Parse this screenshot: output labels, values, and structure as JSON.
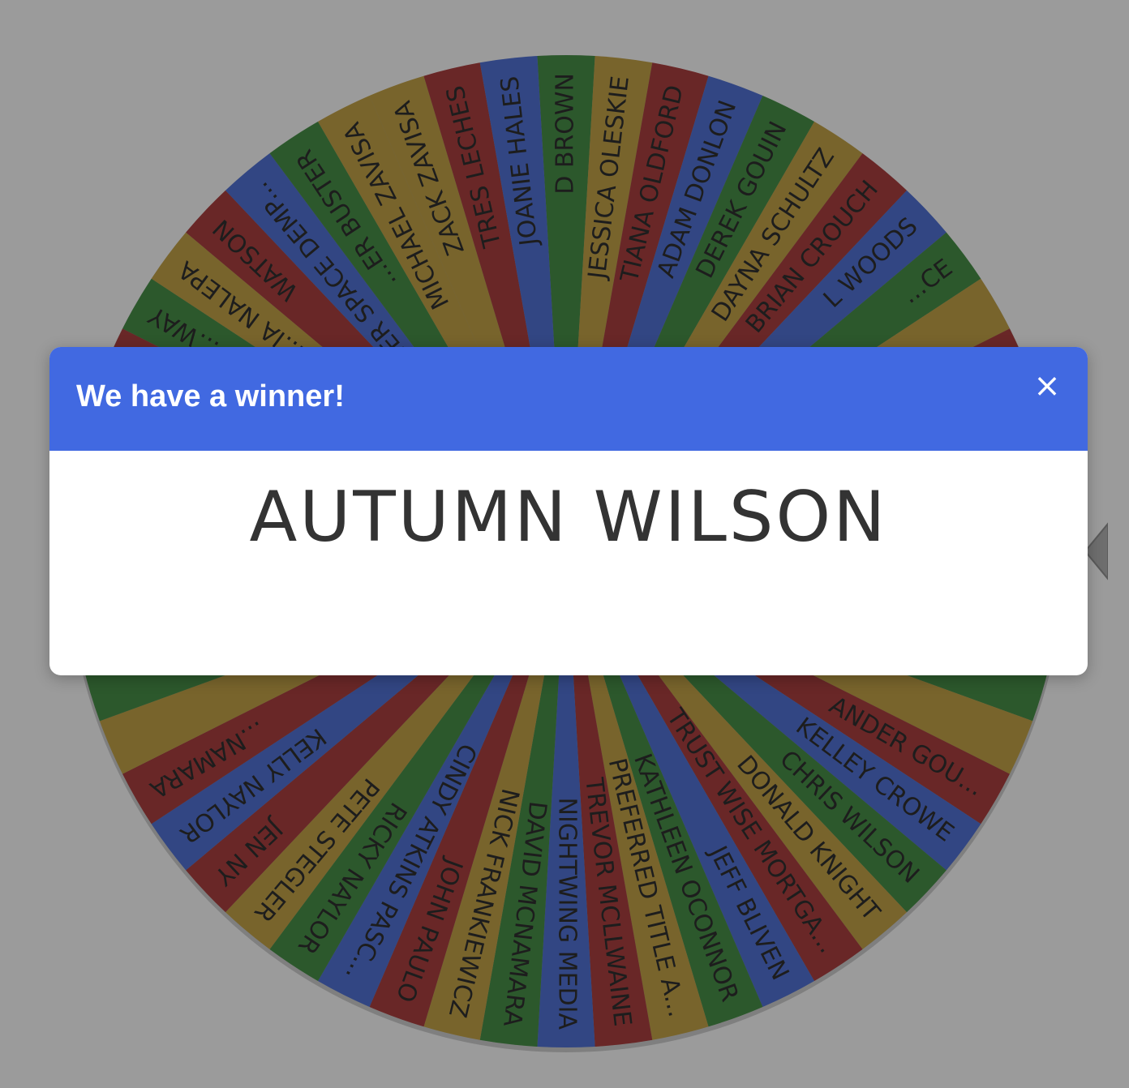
{
  "wheel": {
    "entries": [
      {
        "label": "D BROWN",
        "color": "#266326"
      },
      {
        "label": "JESSICA OLESKIE",
        "color": "#8f7326"
      },
      {
        "label": "TIANA OLDFORD",
        "color": "#7a1f1f"
      },
      {
        "label": "ADAM DONLON",
        "color": "#2e4a9e"
      },
      {
        "label": "DEREK GOUIN",
        "color": "#266326"
      },
      {
        "label": "DAYNA SCHULTZ",
        "color": "#8f7326"
      },
      {
        "label": "BRIAN CROUCH",
        "color": "#7a1f1f"
      },
      {
        "label": "L WOODS",
        "color": "#2e4a9e"
      },
      {
        "label": "...CE",
        "color": "#266326"
      },
      {
        "label": "",
        "color": "#8f7326"
      },
      {
        "label": "",
        "color": "#7a1f1f"
      },
      {
        "label": "",
        "color": "#2e4a9e"
      },
      {
        "label": "",
        "color": "#266326"
      },
      {
        "label": "",
        "color": "#8f7326"
      },
      {
        "label": "",
        "color": "#7a1f1f"
      },
      {
        "label": "",
        "color": "#2e4a9e"
      },
      {
        "label": "",
        "color": "#266326"
      },
      {
        "label": "",
        "color": "#8f7326"
      },
      {
        "label": "ANDER GOU...",
        "color": "#7a1f1f"
      },
      {
        "label": "KELLEY CROWE",
        "color": "#2e4a9e"
      },
      {
        "label": "CHRIS WILSON",
        "color": "#266326"
      },
      {
        "label": "DONALD KNIGHT",
        "color": "#8f7326"
      },
      {
        "label": "TRUST WISE MORTGA...",
        "color": "#7a1f1f"
      },
      {
        "label": "JEFF BLIVEN",
        "color": "#2e4a9e"
      },
      {
        "label": "KATHLEEN OCONNOR",
        "color": "#266326"
      },
      {
        "label": "PREFERRED TITLE A...",
        "color": "#8f7326"
      },
      {
        "label": "TREVOR MCLLWAINE",
        "color": "#7a1f1f"
      },
      {
        "label": "NIGHTWING MEDIA",
        "color": "#2e4a9e"
      },
      {
        "label": "DAVID MCNAMARA",
        "color": "#266326"
      },
      {
        "label": "NICK FRANKIEWICZ",
        "color": "#8f7326"
      },
      {
        "label": "JOHN PAULO",
        "color": "#7a1f1f"
      },
      {
        "label": "CINDY ATKINS PASC...",
        "color": "#2e4a9e"
      },
      {
        "label": "RICKY NAYLOR",
        "color": "#266326"
      },
      {
        "label": "PETE STEGLER",
        "color": "#8f7326"
      },
      {
        "label": "JEN NY",
        "color": "#7a1f1f"
      },
      {
        "label": "KELLY NAYLOR",
        "color": "#2e4a9e"
      },
      {
        "label": "...NAMARA",
        "color": "#7a1f1f"
      },
      {
        "label": "",
        "color": "#8f7326"
      },
      {
        "label": "",
        "color": "#266326"
      },
      {
        "label": "",
        "color": "#2e4a9e"
      },
      {
        "label": "",
        "color": "#7a1f1f"
      },
      {
        "label": "",
        "color": "#8f7326"
      },
      {
        "label": "",
        "color": "#266326"
      },
      {
        "label": "",
        "color": "#2e4a9e"
      },
      {
        "label": "",
        "color": "#7a1f1f"
      },
      {
        "label": "...WAY",
        "color": "#266326"
      },
      {
        "label": "...IA NALEPA",
        "color": "#8f7326"
      },
      {
        "label": "WATSON",
        "color": "#7a1f1f"
      },
      {
        "label": "...ER SPACE DEMP...",
        "color": "#2e4a9e"
      },
      {
        "label": "...ER BUSTER",
        "color": "#266326"
      },
      {
        "label": "MICHAEL ZAVISA",
        "color": "#8f7326"
      },
      {
        "label": "ZACK ZAVISA",
        "color": "#8f7326"
      },
      {
        "label": "TRES LECHES",
        "color": "#7a1f1f"
      },
      {
        "label": "JOANIE HALES",
        "color": "#2e4a9e"
      }
    ]
  },
  "modal": {
    "title": "We have a winner!",
    "close_label": "×",
    "winner": "AUTUMN WILSON"
  },
  "colors": {
    "backdrop": "#9b9b9b",
    "header": "#4169e1"
  }
}
